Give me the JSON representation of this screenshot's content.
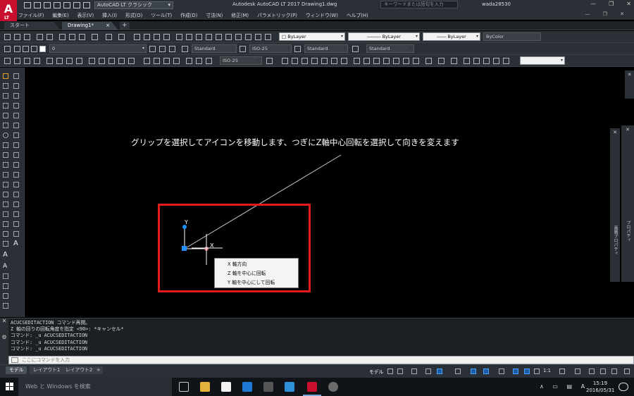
{
  "titlebar": {
    "app_logo": "A",
    "app_logo_sub": "LT",
    "workspace": "AutoCAD LT クラシック",
    "window_title": "Autodesk AutoCAD LT 2017    Drawing1.dwg",
    "search_placeholder": "キーワードまたは語句を入力",
    "user": "wada28530",
    "controls": [
      "—",
      "❐",
      "✕"
    ]
  },
  "menubar": {
    "items": [
      "ファイル(F)",
      "編集(E)",
      "表示(V)",
      "挿入(I)",
      "形式(O)",
      "ツール(T)",
      "作成(D)",
      "寸法(N)",
      "修正(M)",
      "パラメトリック(P)",
      "ウィンドウ(W)",
      "ヘルプ(H)"
    ],
    "right_controls": "— ❐ ✕"
  },
  "tabs": {
    "start": "スタート",
    "drawing": "Drawing1*",
    "drawing_close": "×",
    "add": "+"
  },
  "toolbar": {
    "layer_color": "ByLayer",
    "linetype": "ByLayer",
    "lineweight": "ByLayer",
    "plotstyle": "ByColor",
    "layer_name": "0",
    "text_style": "Standard",
    "dim_style": "ISO-25",
    "table_style": "Standard",
    "mleader_style": "Standard",
    "dim_style_2": "ISO-25"
  },
  "canvas": {
    "annotation": "グリップを選択してアイコンを移動します、つぎにZ軸中心回転を選択して向きを変えます",
    "ucs_y_label": "Y",
    "ucs_x_label": "X",
    "context_menu": [
      "X 軸方向",
      "Z 軸を中心に回転",
      "Y 軸を中心にして回転"
    ]
  },
  "right_palettes": {
    "properties_label": "プロパティ",
    "layer_label": "画層プロパティ"
  },
  "command": {
    "history": [
      "ACUCSEDITACTION コマンド再開。",
      "Z 軸の回りの回転角度を指定 <90>: *キャンセル*",
      "コマンド: _u ACUCSEDITACTION",
      "コマンド: _u ACUCSEDITACTION",
      "コマンド: _u ACUCSEDITACTION"
    ],
    "input_placeholder": "ここにコマンドを入力"
  },
  "statusbar": {
    "layout_tabs": [
      "モデル",
      "レイアウト1",
      "レイアウト2"
    ],
    "add_layout": "+",
    "model_label": "モデル",
    "scale": "1:1"
  },
  "taskbar": {
    "search_text": "Web と Windows を検索",
    "time": "15:19",
    "date": "2016/05/31",
    "ime": "A"
  },
  "colors": {
    "highlight_box": "#e21b1b",
    "ucs_grip": "#1e90ff",
    "ucs_axis": "#ffffff",
    "rubber_band": "#c8c8c8"
  }
}
